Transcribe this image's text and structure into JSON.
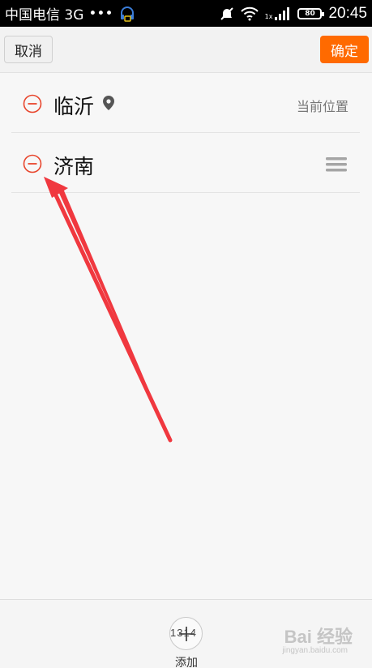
{
  "status_bar": {
    "carrier": "中国电信 3G",
    "dots": "•••",
    "time": "20:45",
    "battery": "80",
    "network_label": "1x"
  },
  "action_bar": {
    "cancel_label": "取消",
    "confirm_label": "确定",
    "accent_color": "#ff6a00"
  },
  "cities": [
    {
      "name": "临沂",
      "tag": "当前位置",
      "is_current": true
    },
    {
      "name": "济南",
      "tag": "",
      "is_current": false
    }
  ],
  "bottom_bar": {
    "add_label": "添加",
    "overlap_text": "1314"
  },
  "watermark": {
    "brand": "Bai 经验",
    "domain": "jingyan.baidu.com"
  },
  "colors": {
    "remove_icon": "#e8452c",
    "annotation_arrow": "#f0383f"
  }
}
